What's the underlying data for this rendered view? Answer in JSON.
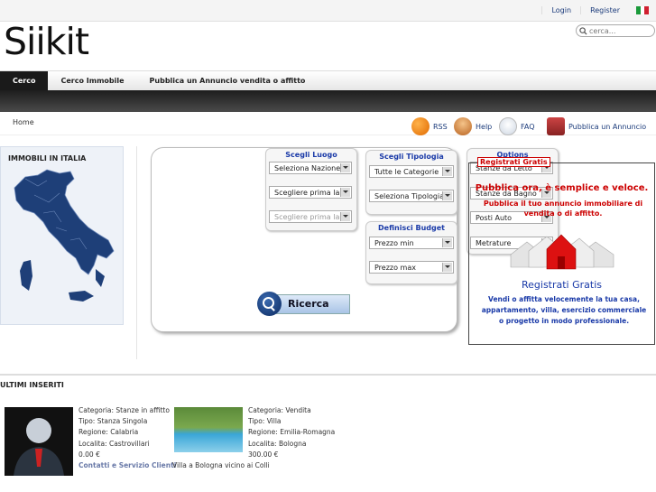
{
  "topbar": {
    "login": "Login",
    "register": "Register",
    "flag": "it-flag"
  },
  "logo": "Siikit",
  "search": {
    "placeholder": "cerca..."
  },
  "nav": [
    "Cerco",
    "Cerco Immobile",
    "Pubblica un Annuncio vendita o affitto"
  ],
  "breadcrumb": {
    "home": "Home"
  },
  "quick_links": {
    "rss": "RSS",
    "help": "Help",
    "faq": "FAQ",
    "pubblica": "Pubblica un Annuncio"
  },
  "italy": {
    "title": "IMMOBILI IN ITALIA"
  },
  "luogo": {
    "title": "Scegli Luogo",
    "nazione": "Seleziona Nazione",
    "regione": "Scegliere prima la N",
    "provincia": "Scegliere prima la R"
  },
  "tipologia": {
    "title": "Scegli Tipologia",
    "categorie": "Tutte le Categorie",
    "tipologia": "Seleziona Tipologia"
  },
  "budget": {
    "title": "Definisci Budget",
    "min": "Prezzo min",
    "max": "Prezzo max"
  },
  "options": {
    "title": "Options",
    "letto": "Stanze da Letto",
    "bagno": "Stanze da Bagno",
    "auto": "Posti Auto",
    "metrature": "Metrature"
  },
  "ricerca": "Ricerca",
  "promo": {
    "tag": "Registrati Gratis",
    "headline": "Pubblica ora, è semplice e veloce.",
    "sub": "Pubblica il tuo annuncio immobiliare di vendita o di affitto.",
    "title": "Registrati Gratis",
    "desc": "Vendi o affitta velocemente la tua casa, appartamento, villa, esercizio commerciale o progetto in modo professionale."
  },
  "ultimi": {
    "title": "ULTIMI INSERITI",
    "cards": [
      {
        "categoria": "Categoria: Stanze in affitto",
        "tipo": "Tipo: Stanza Singola",
        "regione": "Regione: Calabria",
        "localita": "Localita: Castrovillari",
        "prezzo": "0.00 €",
        "titolo": "Contatti e Servizio Clienti"
      },
      {
        "categoria": "Categoria: Vendita",
        "tipo": "Tipo: Villa",
        "regione": "Regione: Emilia-Romagna",
        "localita": "Localita: Bologna",
        "prezzo": "300.00 €",
        "titolo": "Villa a Bologna vicino ai Colli"
      }
    ]
  },
  "colors": {
    "accent_red": "#cc0000",
    "accent_blue": "#1a3aa8",
    "nav_dark": "#1a1a1a"
  }
}
